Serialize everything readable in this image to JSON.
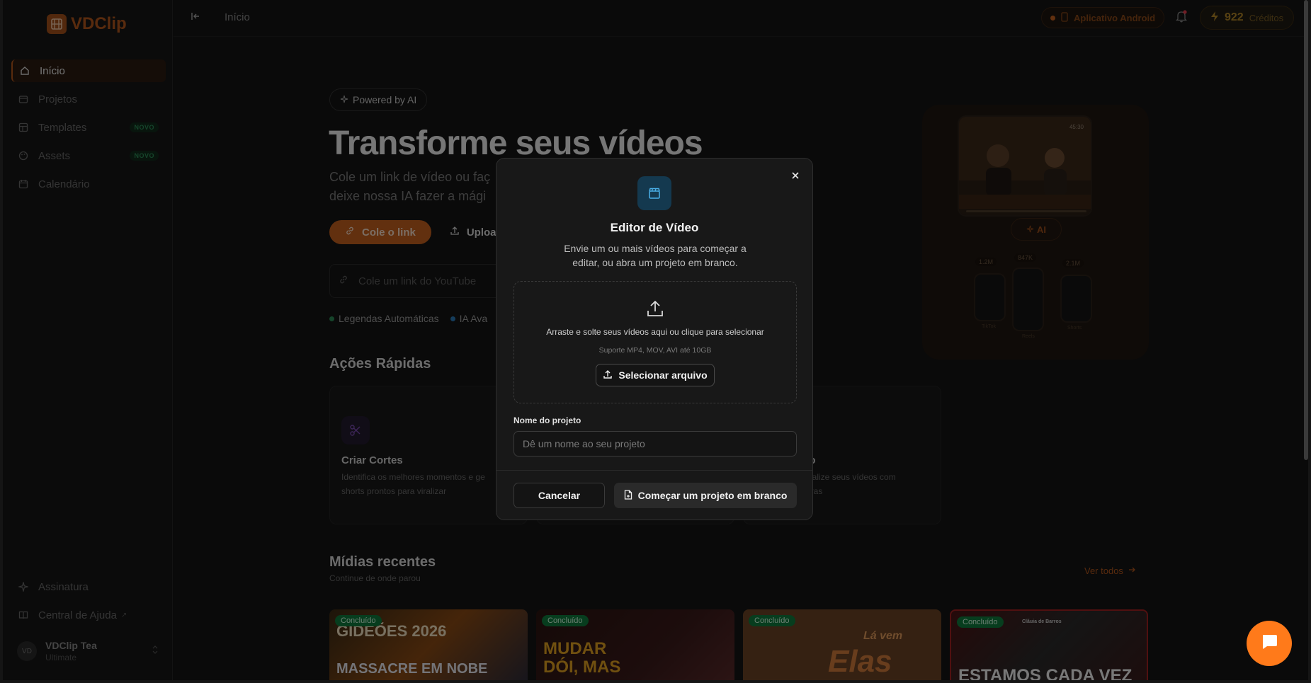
{
  "app": {
    "name": "VDClip"
  },
  "sidebar": {
    "items": [
      {
        "label": "Início",
        "icon": "home-icon",
        "active": true
      },
      {
        "label": "Projetos",
        "icon": "folder-icon"
      },
      {
        "label": "Templates",
        "icon": "template-icon",
        "badge": "NOVO"
      },
      {
        "label": "Assets",
        "icon": "palette-icon",
        "badge": "NOVO"
      },
      {
        "label": "Calendário",
        "icon": "calendar-icon"
      }
    ],
    "bottom_items": [
      {
        "label": "Assinatura",
        "icon": "sparkle-icon"
      },
      {
        "label": "Central de Ajuda",
        "icon": "book-icon",
        "suffix": "↗"
      }
    ],
    "user": {
      "initials": "VD",
      "name": "VDClip Tea",
      "plan": "Ultimate"
    }
  },
  "topbar": {
    "breadcrumb": "Início",
    "android_label": "Aplicativo Android",
    "credits_value": "922",
    "credits_label": "Créditos"
  },
  "hero": {
    "powered": "Powered by AI",
    "title": "Transforme seus vídeos",
    "subtitle_line1": "Cole um link de vídeo ou faç",
    "subtitle_line2": "deixe nossa IA fazer a mági",
    "btn_link": "Cole o link",
    "btn_upload": "Upload",
    "input_placeholder": "Cole um link do YouTube",
    "features": [
      {
        "label": "Legendas Automáticas",
        "color": "#2d8b57"
      },
      {
        "label": "IA Ava",
        "color": "#2a7ab8"
      }
    ]
  },
  "preview": {
    "ai_label": "AI",
    "time": "45:30",
    "stats": [
      "1.2M",
      "847K",
      "2.1M"
    ],
    "platforms": [
      "TikTok",
      "Reels",
      "Shorts"
    ]
  },
  "quick_actions": {
    "title": "Ações Rápidas",
    "cards": [
      {
        "title": "Criar Cortes",
        "desc_line1": "Identifica os melhores momentos e ge",
        "desc_line2": "shorts prontos para viralizar"
      },
      {
        "title": "eo",
        "desc_line1": "finalize seus vídeos com",
        "desc_line2": "ltivas"
      }
    ]
  },
  "recent": {
    "title": "Mídias recentes",
    "subtitle": "Continue de onde parou",
    "see_all": "Ver todos",
    "items": [
      {
        "badge": "Concluído",
        "text_top": "GIDEÕES 2026",
        "text_bottom": "MASSACRE EM NOBE"
      },
      {
        "badge": "Concluído",
        "text_top": "MUDAR",
        "text_bottom": "DÓI, MAS"
      },
      {
        "badge": "Concluído",
        "text_top": "Lá vem",
        "text_bottom": "Elas"
      },
      {
        "badge": "Concluído",
        "text_top": "Clãuia de Barros",
        "text_bottom": "ESTAMOS CADA VEZ"
      }
    ]
  },
  "modal": {
    "title": "Editor de Vídeo",
    "desc_line1": "Envie um ou mais vídeos para começar a",
    "desc_line2": "editar, ou abra um projeto em branco.",
    "dropzone_text": "Arraste e solte seus vídeos aqui ou clique para selecionar",
    "dropzone_sub": "Suporte MP4, MOV, AVI até 10GB",
    "select_button": "Selecionar arquivo",
    "name_label": "Nome do projeto",
    "name_placeholder": "Dê um nome ao seu projeto",
    "cancel": "Cancelar",
    "blank_project": "Começar um projeto em branco"
  },
  "colors": {
    "accent": "#c4611f",
    "modal_icon_bg": "#14394f",
    "success": "#0f7a3c"
  }
}
